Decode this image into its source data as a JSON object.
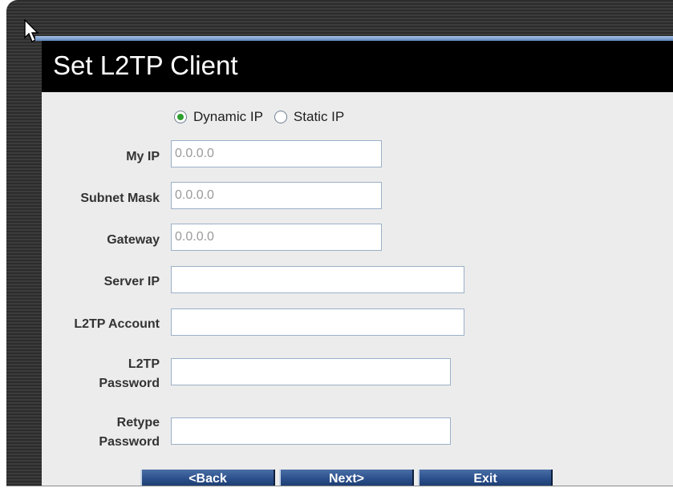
{
  "page": {
    "title": "Set L2TP Client"
  },
  "ip_mode": {
    "options": [
      {
        "label": "Dynamic IP",
        "selected": true
      },
      {
        "label": "Static IP",
        "selected": false
      }
    ]
  },
  "fields": {
    "my_ip": {
      "label": "My IP",
      "value": "0.0.0.0"
    },
    "subnet_mask": {
      "label": "Subnet Mask",
      "value": "0.0.0.0"
    },
    "gateway": {
      "label": "Gateway",
      "value": "0.0.0.0"
    },
    "server_ip": {
      "label": "Server IP",
      "value": ""
    },
    "l2tp_account": {
      "label": "L2TP Account",
      "value": ""
    },
    "l2tp_password": {
      "label_line1": "L2TP",
      "label_line2": "Password",
      "value": ""
    },
    "retype_password": {
      "label_line1": "Retype",
      "label_line2": "Password",
      "value": ""
    }
  },
  "buttons": {
    "back": "<Back",
    "next": "Next>",
    "exit": "Exit"
  },
  "colors": {
    "title_bg": "#000000",
    "panel_bg": "#ececec",
    "button_blue": "#2a4e8a",
    "radio_selected": "#2f9e2f"
  }
}
